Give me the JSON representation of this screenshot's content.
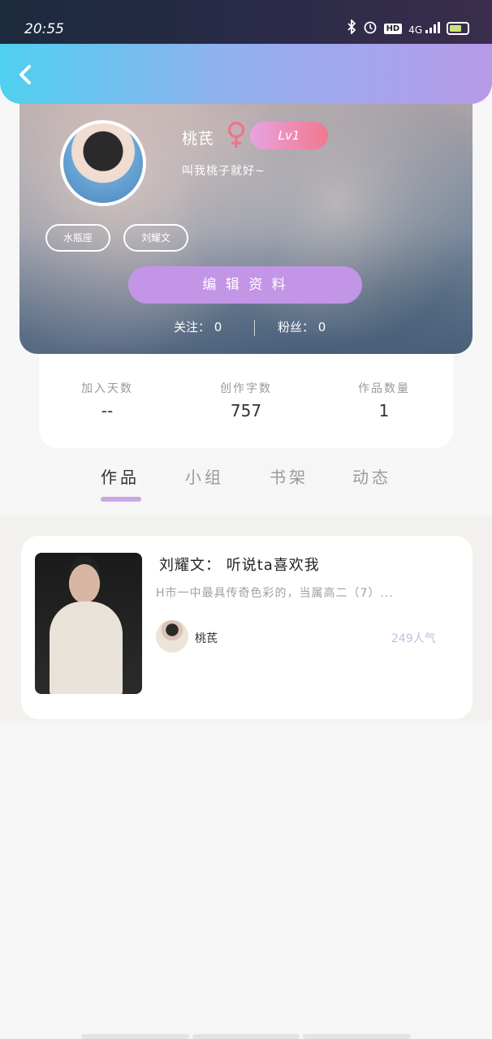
{
  "status_bar": {
    "time": "20:55",
    "hd": "HD",
    "network": "4G",
    "battery": "11"
  },
  "profile": {
    "nickname": "桃芪",
    "level": "Lv1",
    "bio": "叫我桃子就好~",
    "tags": [
      "水瓶座",
      "刘耀文"
    ],
    "edit_label": "编 辑 资 料",
    "following_label": "关注：",
    "following_count": "0",
    "fans_label": "粉丝：",
    "fans_count": "0"
  },
  "stats": [
    {
      "label": "加入天数",
      "value": "--"
    },
    {
      "label": "创作字数",
      "value": "757"
    },
    {
      "label": "作品数量",
      "value": "1"
    }
  ],
  "tabs": [
    "作品",
    "小组",
    "书架",
    "动态"
  ],
  "active_tab": 0,
  "works": [
    {
      "title": "刘耀文： 听说ta喜欢我",
      "excerpt": "H市一中最具传奇色彩的，当属高二（7）...",
      "author": "桃芪",
      "popularity": "249人气"
    }
  ],
  "colors": {
    "header_gradient_start": "#4fd0ef",
    "header_gradient_end": "#b79ae8",
    "accent_purple": "#c395e6",
    "female_pink": "#f0738c",
    "popularity_text": "#cdb7e5"
  },
  "icons": [
    "back-icon",
    "female-icon",
    "bluetooth-icon",
    "alarm-icon",
    "signal-icon",
    "battery-icon"
  ]
}
